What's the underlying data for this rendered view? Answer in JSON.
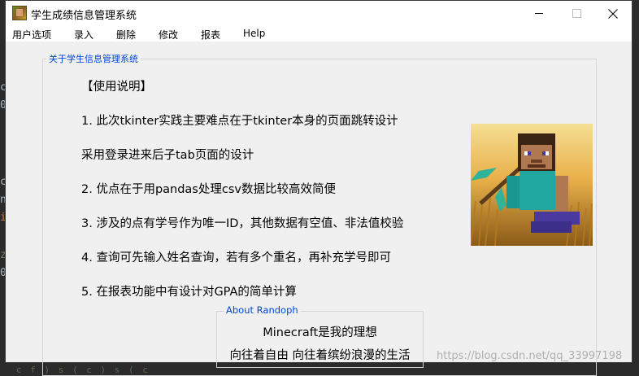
{
  "window": {
    "title": "学生成绩信息管理系统",
    "icon": "minecraft-app-icon"
  },
  "menubar": {
    "items": [
      {
        "label": "用户选项"
      },
      {
        "label": "录入"
      },
      {
        "label": "删除"
      },
      {
        "label": "修改"
      },
      {
        "label": "报表"
      },
      {
        "label": "Help"
      }
    ]
  },
  "about_frame": {
    "title": "关于学生信息管理系统",
    "lines": [
      "【使用说明】",
      "1. 此次tkinter实践主要难点在于tkinter本身的页面跳转设计",
      "采用登录进来后子tab页面的设计",
      "2. 优点在于用pandas处理csv数据比较高效简便",
      "3. 涉及的点有学号作为唯一ID，其他数据有空值、非法值校验",
      "4. 查询可先输入姓名查询，若有多个重名，再补充学号即可",
      "5. 在报表功能中有设计对GPA的简单计算"
    ],
    "image": "minecraft-steve-picture"
  },
  "about_randoph": {
    "title": "About Randoph",
    "lines": [
      "Minecraft是我的理想",
      "向往着自由 向往着缤纷浪漫的生活"
    ]
  },
  "watermark": "https://blog.csdn.net/qq_33997198",
  "background_editor": {
    "chars": [
      "c",
      "0",
      "c",
      "n",
      "i",
      "z",
      "0"
    ],
    "bottom_code": "c     f         )    s     (     c          )      s      (     c"
  },
  "colors": {
    "frame_title": "#0046d5",
    "titlebar": "#ffffff",
    "window_bg": "#f0f0f0"
  }
}
